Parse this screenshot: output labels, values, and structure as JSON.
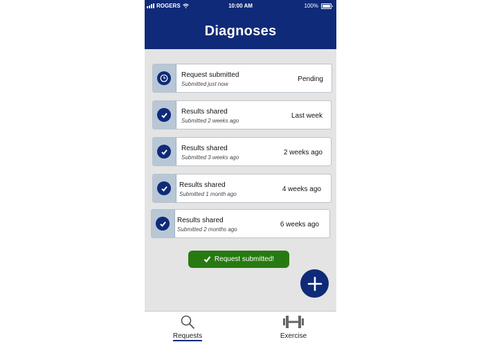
{
  "status_bar": {
    "carrier": "ROGERS",
    "time": "10:00 AM",
    "battery": "100%"
  },
  "header": {
    "title": "Diagnoses"
  },
  "cards": [
    {
      "label": "Request submitted",
      "sub": "Submitted just now",
      "status": "Pending",
      "icon": "clock-icon"
    },
    {
      "label": "Results shared",
      "sub": "Submitted 2 weeks ago",
      "status": "Last week",
      "icon": "check-icon"
    },
    {
      "label": "Results shared",
      "sub": "Submitted 3 weeks ago",
      "status": "2 weeks ago",
      "icon": "check-icon"
    },
    {
      "label": "Results shared",
      "sub": "Submitted 1 month ago",
      "status": "4 weeks ago",
      "icon": "check-icon"
    },
    {
      "label": "Results shared",
      "sub": "Submitted 2 months ago",
      "status": "6 weeks ago",
      "icon": "check-icon"
    }
  ],
  "toast": {
    "text": "Request submitted!"
  },
  "fab": {
    "icon": "plus-icon"
  },
  "nav": {
    "items": [
      {
        "label": "Requests",
        "icon": "search-icon",
        "active": true
      },
      {
        "label": "Exercise",
        "icon": "dumbbell-icon",
        "active": false
      }
    ]
  },
  "colors": {
    "primary": "#0f2a78",
    "success": "#277a11",
    "background": "#e4e4e4",
    "tab": "#b8c7d6"
  }
}
